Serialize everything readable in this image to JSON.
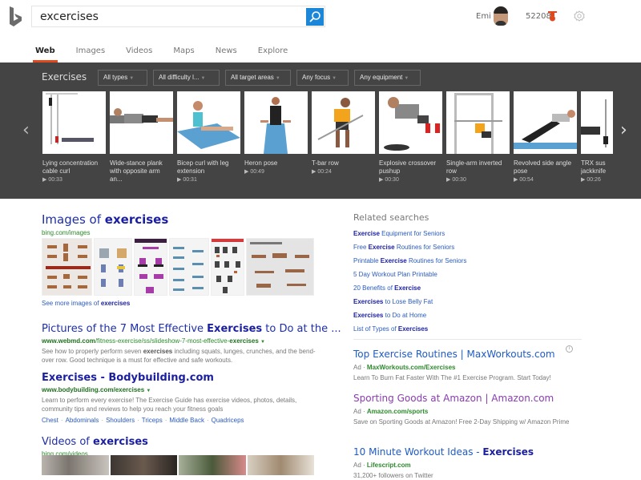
{
  "header": {
    "search_query": "excercises",
    "user_name": "Emi",
    "reward_points": "52208"
  },
  "tabs": [
    {
      "label": "Web",
      "active": true
    },
    {
      "label": "Images",
      "active": false
    },
    {
      "label": "Videos",
      "active": false
    },
    {
      "label": "Maps",
      "active": false
    },
    {
      "label": "News",
      "active": false
    },
    {
      "label": "Explore",
      "active": false
    }
  ],
  "exercises_panel": {
    "title": "Exercises",
    "filters": [
      "All types",
      "All difficulty l...",
      "All target areas",
      "Any focus",
      "Any equipment"
    ],
    "cards": [
      {
        "title": "Lying concentration cable curl",
        "duration": "00:33"
      },
      {
        "title": "Wide-stance plank with opposite arm an...",
        "duration": ""
      },
      {
        "title": "Bicep curl with leg extension",
        "duration": "00:31"
      },
      {
        "title": "Heron pose",
        "duration": "00:49"
      },
      {
        "title": "T-bar row",
        "duration": "00:24"
      },
      {
        "title": "Explosive crossover pushup",
        "duration": "00:30"
      },
      {
        "title": "Single-arm inverted row",
        "duration": "00:30"
      },
      {
        "title": "Revolved side angle pose",
        "duration": "00:54"
      },
      {
        "title": "TRX sus jackknife",
        "duration": "00:26"
      }
    ],
    "prev_arrow": "‹",
    "next_arrow": "›",
    "play_glyph": "▶"
  },
  "results": {
    "images": {
      "title_prefix": "Images of ",
      "title_bold": "exercises",
      "url": "bing.com/images",
      "more_prefix": "See more images of ",
      "more_bold": "exercises"
    },
    "webmd": {
      "title_prefix": "Pictures of the 7 Most Effective ",
      "title_bold": "Exercises",
      "title_suffix": " to Do at the ...",
      "url_domain": "www.webmd.com",
      "url_path": "/fitness-exercise/ss/slideshow-7-most-effective-",
      "url_bold": "exercises",
      "snippet_prefix": "See how to properly perform seven ",
      "snippet_bold": "exercises",
      "snippet_suffix": " including squats, lunges, crunches, and the bend-over row. Good technique is a must for effective and safe workouts."
    },
    "bodybuilding": {
      "title": "Exercises - Bodybuilding.com",
      "url": "www.bodybuilding.com/exercises",
      "snippet": "Learn to perform every exercise! The Exercise Guide has exercise videos, photos, details, community tips and reviews to help you reach your fitness goals",
      "deeplinks": [
        "Chest",
        "Abdominals",
        "Shoulders",
        "Triceps",
        "Middle Back",
        "Quadriceps"
      ]
    },
    "videos": {
      "title_prefix": "Videos of ",
      "title_bold": "exercises",
      "url": "bing.com/videos"
    }
  },
  "related": {
    "title": "Related searches",
    "items": [
      {
        "pre": "",
        "bold": "Exercise",
        "post": " Equipment for Seniors"
      },
      {
        "pre": "Free ",
        "bold": "Exercise",
        "post": " Routines for Seniors"
      },
      {
        "pre": "Printable ",
        "bold": "Exercise",
        "post": " Routines for Seniors"
      },
      {
        "pre": "5 Day Workout Plan Printable",
        "bold": "",
        "post": ""
      },
      {
        "pre": "20 Benefits of ",
        "bold": "Exercise",
        "post": ""
      },
      {
        "pre": "",
        "bold": "Exercises",
        "post": " to Lose Belly Fat"
      },
      {
        "pre": "",
        "bold": "Exercises",
        "post": " to Do at Home"
      },
      {
        "pre": "List of Types of ",
        "bold": "Exercises",
        "post": ""
      }
    ]
  },
  "ads": [
    {
      "title": "Top Exercise Routines | MaxWorkouts.com",
      "label": "Ad · ",
      "url": "MaxWorkouts.com/Exercises",
      "desc": "Learn To Burn Fat Faster With The #1 Exercise Program. Start Today!"
    },
    {
      "title": "Sporting Goods at Amazon | Amazon.com",
      "label": "Ad · ",
      "url": "Amazon.com/sports",
      "desc": "Save on Sporting Goods at Amazon! Free 2-Day Shipping w/ Amazon Prime"
    },
    {
      "title_prefix": "10 Minute Workout Ideas - ",
      "title_bold": "Exercises",
      "label": "Ad · ",
      "url": "Lifescript.com",
      "desc": "31,200+ followers on Twitter"
    }
  ],
  "info_glyph": "i",
  "colors": {
    "accent": "#e0481e",
    "search_button": "#1c86d8",
    "link": "#1e2ea8",
    "url_green": "#2b8a2b",
    "panel_bg": "#444444"
  }
}
